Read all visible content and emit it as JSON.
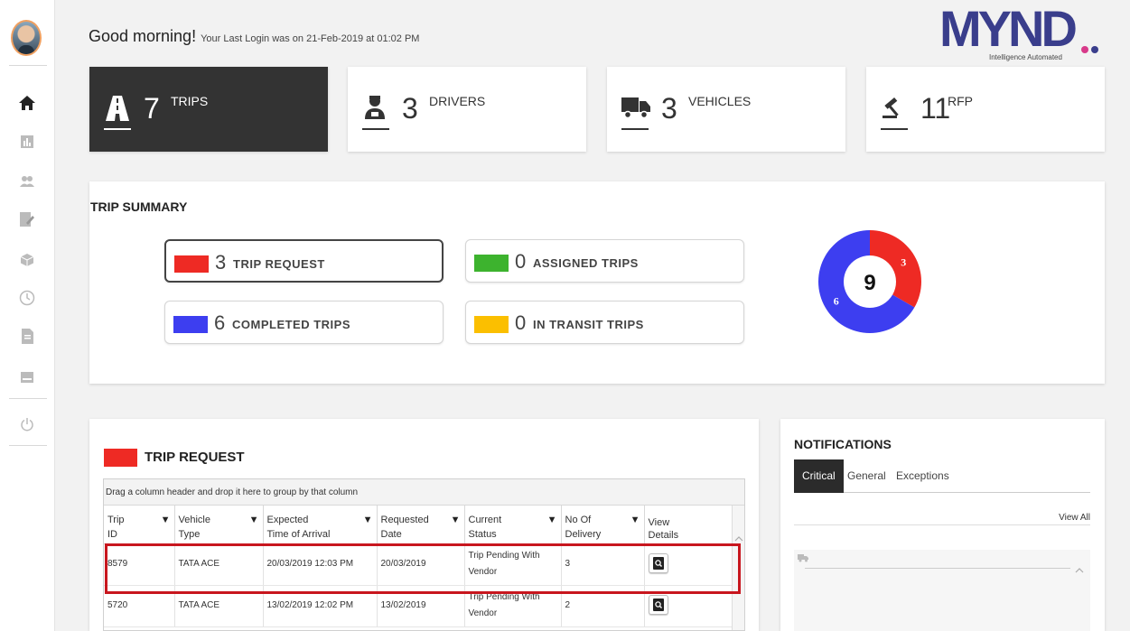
{
  "header": {
    "greeting": "Good morning!",
    "last_login": "Your Last Login was on 21-Feb-2019 at 01:02 PM"
  },
  "logo": {
    "text": "MYND",
    "tagline": "Intelligence Automated"
  },
  "sidebar": {
    "items": [
      {
        "icon": "home-icon"
      },
      {
        "icon": "reports-icon"
      },
      {
        "icon": "users-icon"
      },
      {
        "icon": "edit-document-icon"
      },
      {
        "icon": "package-icon"
      },
      {
        "icon": "history-icon"
      },
      {
        "icon": "file-icon"
      },
      {
        "icon": "billing-icon"
      },
      {
        "icon": "power-icon"
      }
    ]
  },
  "stats": [
    {
      "value": "7",
      "label": "TRIPS",
      "icon": "road-icon"
    },
    {
      "value": "3",
      "label": "DRIVERS",
      "icon": "driver-icon"
    },
    {
      "value": "3",
      "label": "VEHICLES",
      "icon": "truck-icon"
    },
    {
      "value": "11",
      "label": "RFP",
      "icon": "gavel-icon"
    }
  ],
  "summary": {
    "title": "TRIP SUMMARY",
    "items": [
      {
        "count": "3",
        "label": "TRIP REQUEST",
        "color": "#ee2a24"
      },
      {
        "count": "0",
        "label": "ASSIGNED TRIPS",
        "color": "#3db32e"
      },
      {
        "count": "6",
        "label": "COMPLETED TRIPS",
        "color": "#3d3ef0"
      },
      {
        "count": "0",
        "label": "IN TRANSIT TRIPS",
        "color": "#fbbf00"
      }
    ],
    "donut": {
      "total": "9",
      "slices": [
        {
          "value": 3,
          "label": "3",
          "color": "#ee2a24"
        },
        {
          "value": 6,
          "label": "6",
          "color": "#3d3ef0"
        }
      ]
    }
  },
  "trip_request": {
    "title": "TRIP REQUEST",
    "group_hint": "Drag a column header and drop it here to group by that column",
    "columns": [
      [
        "Trip",
        "ID"
      ],
      [
        "Vehicle",
        "Type"
      ],
      [
        "Expected",
        "Time of Arrival"
      ],
      [
        "Requested",
        "Date"
      ],
      [
        "Current",
        "Status"
      ],
      [
        "No Of",
        "Delivery"
      ],
      [
        "View",
        "Details"
      ]
    ],
    "rows": [
      [
        "8579",
        "TATA ACE",
        "20/03/2019 12:03 PM",
        "20/03/2019",
        "Trip Pending With Vendor",
        "3"
      ],
      [
        "5720",
        "TATA ACE",
        "13/02/2019 12:02 PM",
        "13/02/2019",
        "Trip Pending With Vendor",
        "2"
      ]
    ]
  },
  "notifications": {
    "title": "NOTIFICATIONS",
    "tabs": [
      "Critical",
      "General",
      "Exceptions"
    ],
    "active_tab": "Critical",
    "view_all": "View All"
  }
}
